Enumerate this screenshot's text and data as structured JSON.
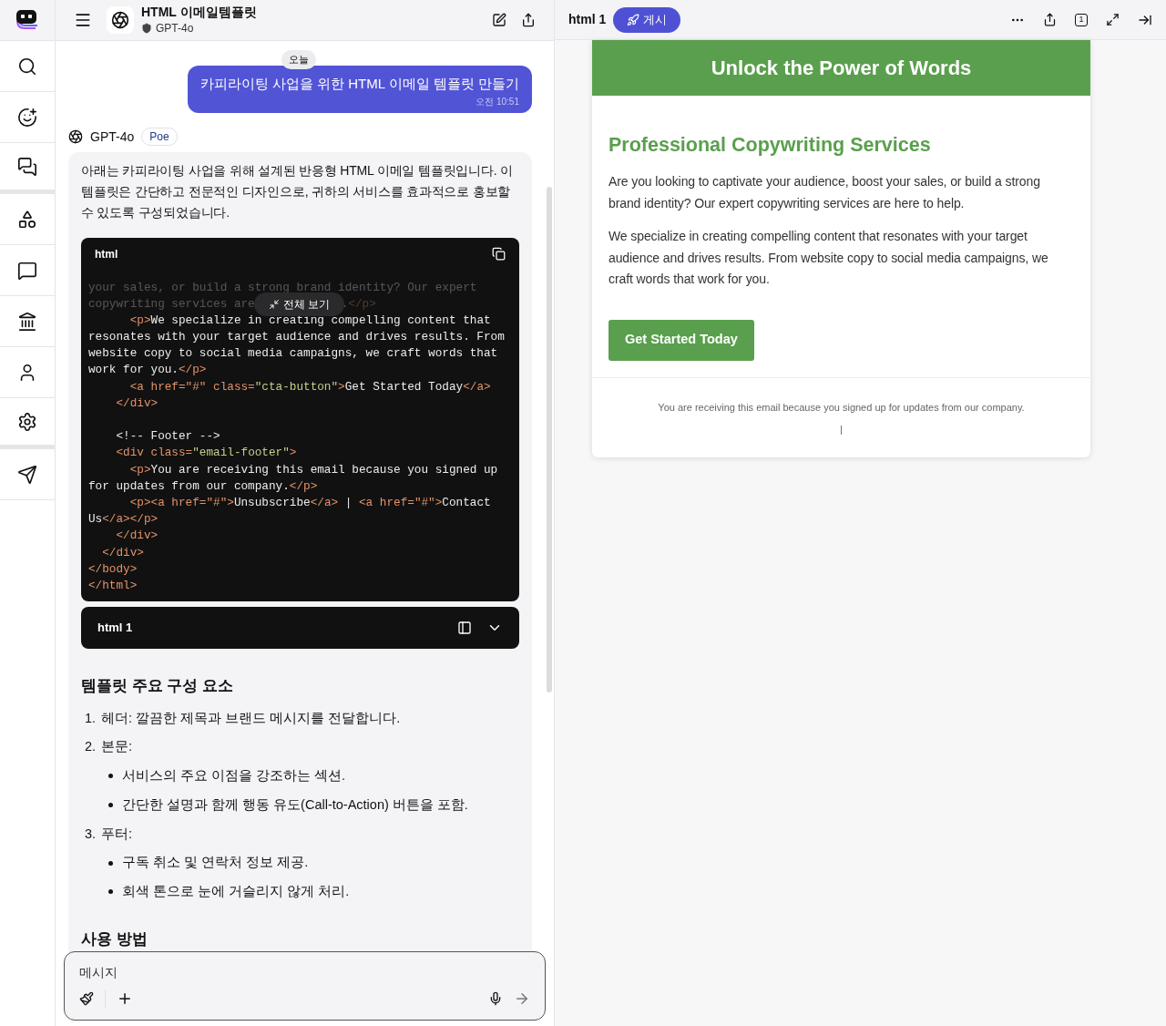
{
  "header": {
    "title": "HTML 이메일템플릿",
    "bot": "GPT-4o"
  },
  "chat": {
    "date_label": "오늘",
    "user_message": {
      "text": "카피라이팅 사업을 위한 HTML 이메일 템플릿 만들기",
      "time": "오전 10:51"
    },
    "reply": {
      "bot": "GPT-4o",
      "badge": "Poe",
      "intro": "아래는 카피라이팅 사업을 위해 설계된 반응형 HTML 이메일 템플릿입니다. 이 템플릿은 간단하고 전문적인 디자인으로, 귀하의 서비스를 효과적으로 홍보할 수 있도록 구성되었습니다.",
      "code": {
        "language": "html",
        "expand_label": "전체 보기",
        "lines": [
          {
            "kind": "faded",
            "segments": [
              [
                {
                  "kind": "text",
                  "text": "your sales, or build a strong brand identity? Our expert"
                }
              ]
            ]
          },
          {
            "kind": "faded",
            "segments": [
              [
                {
                  "kind": "text",
                  "text": "copywriting services are"
                }
              ],
              [
                {
                  "kind": "text",
                  "text": "."
                },
                {
                  "kind": "tag",
                  "text": "</p>"
                }
              ]
            ]
          },
          {
            "kind": "code",
            "segments": [
              [
                {
                  "kind": "tag",
                  "text": "      <p>"
                },
                {
                  "kind": "text",
                  "text": "We specialize in creating compelling content that"
                }
              ]
            ]
          },
          {
            "kind": "code",
            "segments": [
              [
                {
                  "kind": "text",
                  "text": "resonates with your target audience and drives results. From"
                }
              ]
            ]
          },
          {
            "kind": "code",
            "segments": [
              [
                {
                  "kind": "text",
                  "text": "website copy to social media campaigns, we craft words that"
                }
              ]
            ]
          },
          {
            "kind": "code",
            "segments": [
              [
                {
                  "kind": "text",
                  "text": "work for you."
                },
                {
                  "kind": "tag",
                  "text": "</p>"
                }
              ]
            ]
          },
          {
            "kind": "code",
            "segments": [
              [
                {
                  "kind": "tag",
                  "text": "      <a href=\"#\" class="
                },
                {
                  "kind": "str",
                  "text": "\"cta-button\""
                },
                {
                  "kind": "tag",
                  "text": ">"
                },
                {
                  "kind": "text",
                  "text": "Get Started Today"
                },
                {
                  "kind": "tag",
                  "text": "</a>"
                }
              ]
            ]
          },
          {
            "kind": "code",
            "segments": [
              [
                {
                  "kind": "tag",
                  "text": "    </div>"
                }
              ]
            ]
          },
          {
            "kind": "blank"
          },
          {
            "kind": "code",
            "segments": [
              [
                {
                  "kind": "text",
                  "text": "    <!-- Footer -->"
                }
              ]
            ]
          },
          {
            "kind": "code",
            "segments": [
              [
                {
                  "kind": "tag",
                  "text": "    <div class="
                },
                {
                  "kind": "str",
                  "text": "\"email-footer\""
                },
                {
                  "kind": "tag",
                  "text": ">"
                }
              ]
            ]
          },
          {
            "kind": "code",
            "segments": [
              [
                {
                  "kind": "tag",
                  "text": "      <p>"
                },
                {
                  "kind": "text",
                  "text": "You are receiving this email because you signed up"
                }
              ]
            ]
          },
          {
            "kind": "code",
            "segments": [
              [
                {
                  "kind": "text",
                  "text": "for updates from our company."
                },
                {
                  "kind": "tag",
                  "text": "</p>"
                }
              ]
            ]
          },
          {
            "kind": "code",
            "segments": [
              [
                {
                  "kind": "tag",
                  "text": "      <p><a href=\"#\">"
                },
                {
                  "kind": "text",
                  "text": "Unsubscribe"
                },
                {
                  "kind": "tag",
                  "text": "</a>"
                },
                {
                  "kind": "text",
                  "text": " | "
                },
                {
                  "kind": "tag",
                  "text": "<a href=\"#\">"
                },
                {
                  "kind": "text",
                  "text": "Contact"
                }
              ]
            ]
          },
          {
            "kind": "code",
            "segments": [
              [
                {
                  "kind": "text",
                  "text": "Us"
                },
                {
                  "kind": "tag",
                  "text": "</a></p>"
                }
              ]
            ]
          },
          {
            "kind": "code",
            "segments": [
              [
                {
                  "kind": "tag",
                  "text": "    </div>"
                }
              ]
            ]
          },
          {
            "kind": "code",
            "segments": [
              [
                {
                  "kind": "tag",
                  "text": "  </div>"
                }
              ]
            ]
          },
          {
            "kind": "code",
            "segments": [
              [
                {
                  "kind": "tag",
                  "text": "</body>"
                }
              ]
            ]
          },
          {
            "kind": "code",
            "segments": [
              [
                {
                  "kind": "tag",
                  "text": "</html>"
                }
              ]
            ]
          }
        ]
      },
      "artifact": {
        "label": "html 1"
      },
      "sections": [
        {
          "heading": "템플릿 주요 구성 요소",
          "items": [
            {
              "number": "1.",
              "text": "헤더: 깔끔한 제목과 브랜드 메시지를 전달합니다."
            },
            {
              "number": "2.",
              "text": "본문:",
              "children": [
                {
                  "text": "서비스의 주요 이점을 강조하는 섹션."
                },
                {
                  "text": "간단한 설명과 함께 행동 유도(Call-to-Action) 버튼을 포함."
                }
              ]
            },
            {
              "number": "3.",
              "text": "푸터:",
              "children": [
                {
                  "text": "구독 취소 및 연락처 정보 제공."
                },
                {
                  "text": "회색 톤으로 눈에 거슬리지 않게 처리."
                }
              ]
            }
          ]
        },
        {
          "heading": "사용 방법"
        }
      ]
    },
    "input": {
      "placeholder": "메시지"
    }
  },
  "preview": {
    "title": "html 1",
    "publish": "게시",
    "page_count": "1",
    "email": {
      "banner": "Unlock the Power of Words",
      "heading": "Professional Copywriting Services",
      "paragraphs": [
        "Are you looking to captivate your audience, boost your sales, or build a strong brand identity? Our expert copywriting services are here to help.",
        "We specialize in creating compelling content that resonates with your target audience and drives results. From website copy to social media campaigns, we craft words that work for you."
      ],
      "cta": "Get Started Today",
      "footer": "You are receiving this email because you signed up for updates from our company.",
      "separator": "|"
    }
  }
}
